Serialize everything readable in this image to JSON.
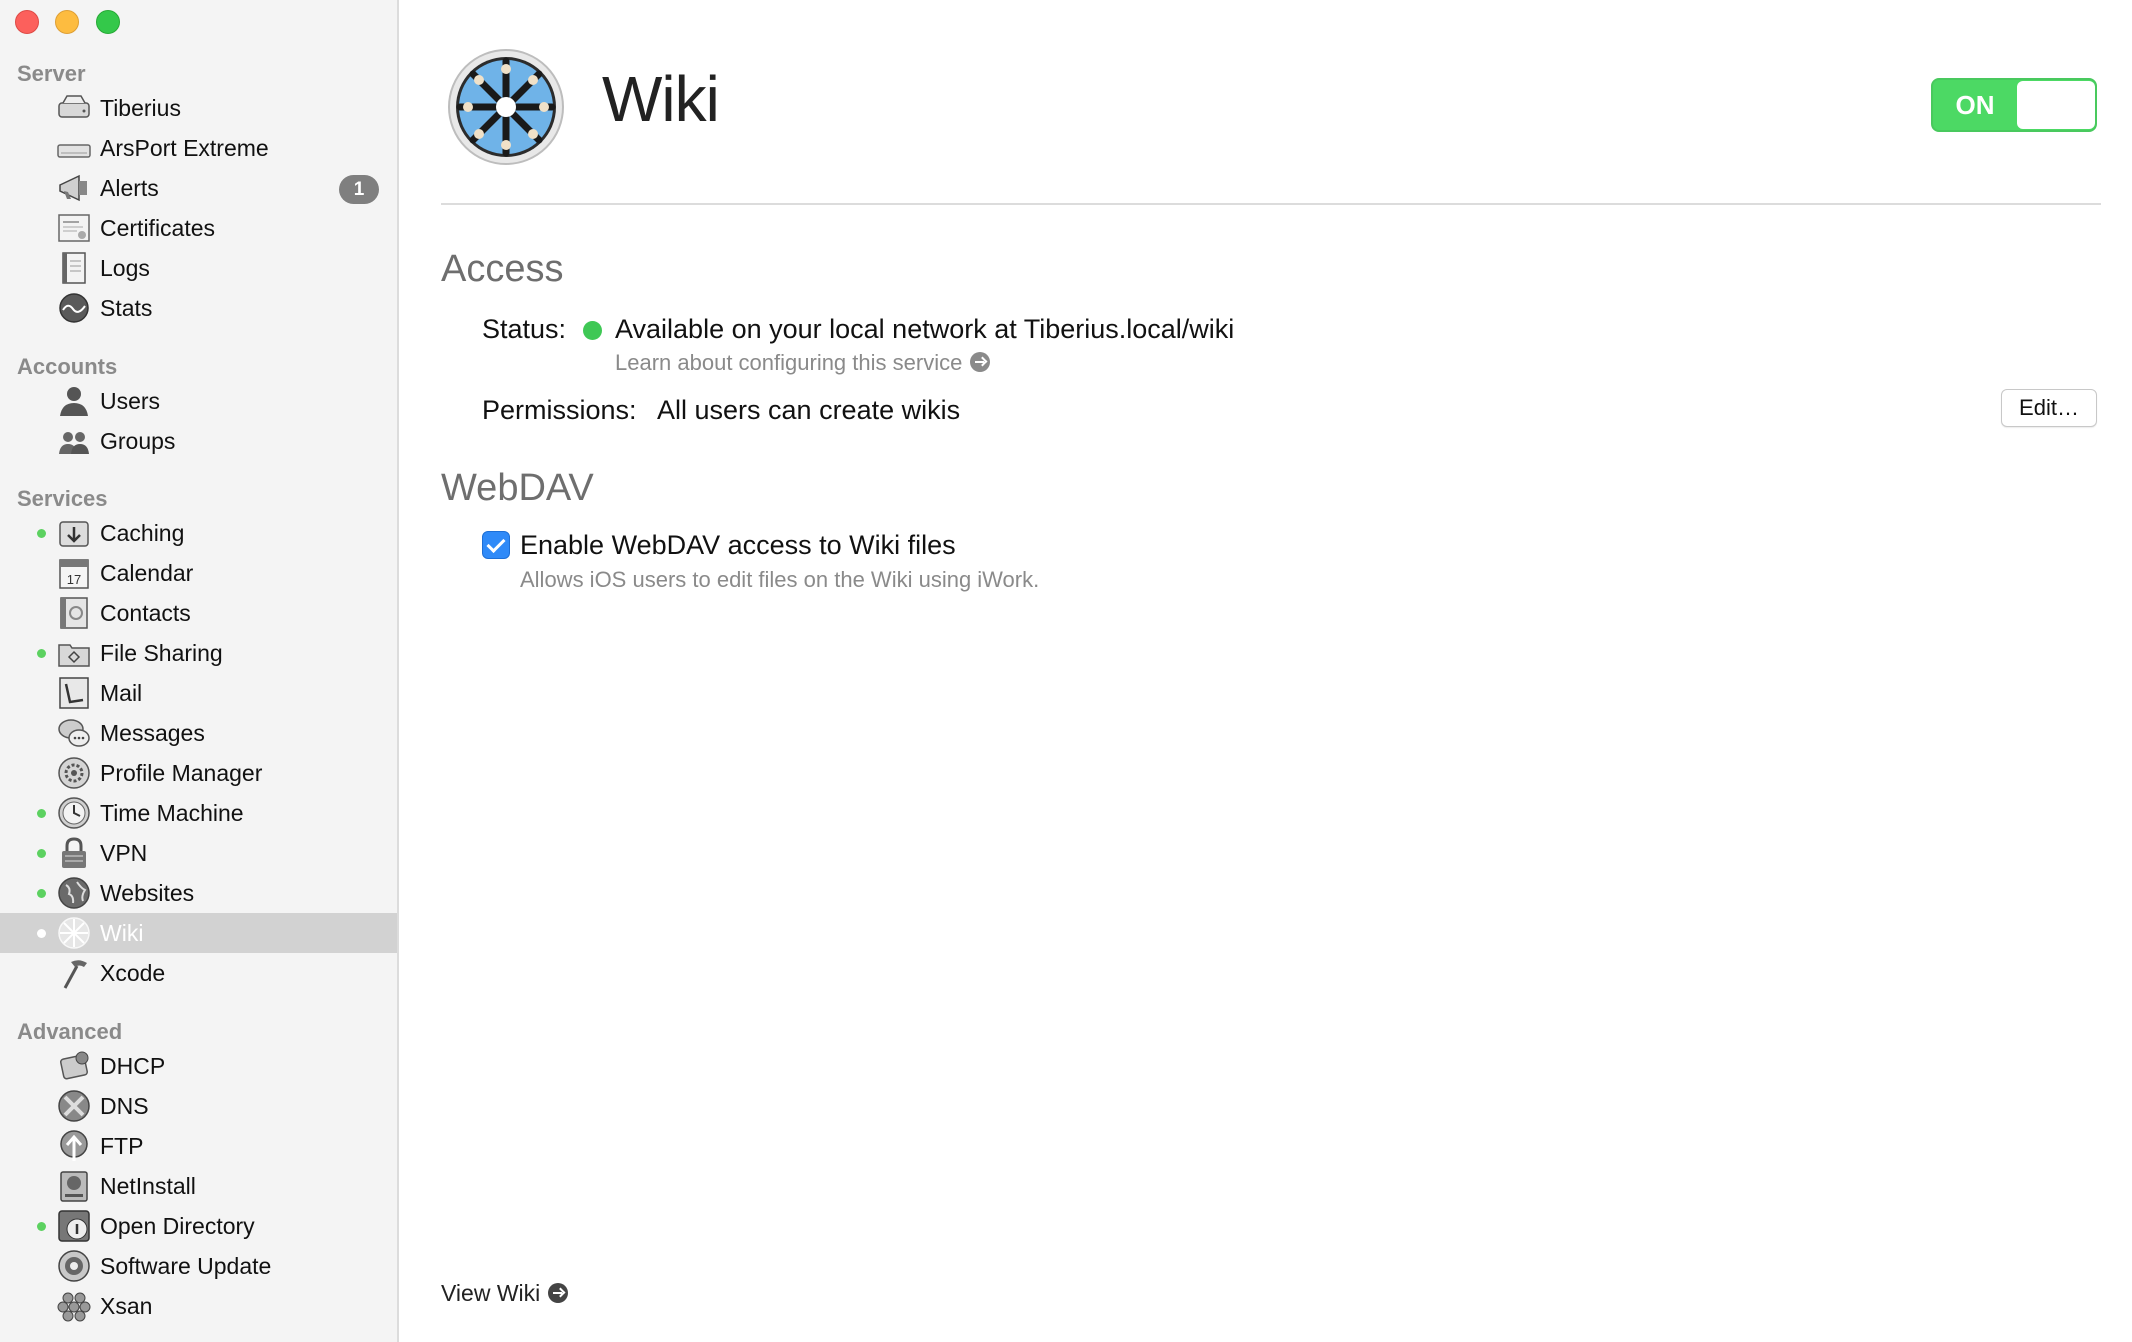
{
  "sidebar": {
    "sections": {
      "server": "Server",
      "accounts": "Accounts",
      "services": "Services",
      "advanced": "Advanced"
    },
    "server_items": [
      {
        "label": "Tiberius",
        "icon": "server-icon"
      },
      {
        "label": "ArsPort Extreme",
        "icon": "airport-icon"
      },
      {
        "label": "Alerts",
        "icon": "megaphone-icon",
        "badge": "1"
      },
      {
        "label": "Certificates",
        "icon": "certificate-icon"
      },
      {
        "label": "Logs",
        "icon": "log-icon"
      },
      {
        "label": "Stats",
        "icon": "stats-icon"
      }
    ],
    "account_items": [
      {
        "label": "Users",
        "icon": "user-icon"
      },
      {
        "label": "Groups",
        "icon": "group-icon"
      }
    ],
    "service_items": [
      {
        "label": "Caching",
        "icon": "caching-icon",
        "running": true
      },
      {
        "label": "Calendar",
        "icon": "calendar-icon",
        "running": false,
        "icon_text": "17"
      },
      {
        "label": "Contacts",
        "icon": "contacts-icon",
        "running": false
      },
      {
        "label": "File Sharing",
        "icon": "file-sharing-icon",
        "running": true
      },
      {
        "label": "Mail",
        "icon": "mail-icon",
        "running": false
      },
      {
        "label": "Messages",
        "icon": "messages-icon",
        "running": false
      },
      {
        "label": "Profile Manager",
        "icon": "profile-manager-icon",
        "running": false
      },
      {
        "label": "Time Machine",
        "icon": "time-machine-icon",
        "running": true
      },
      {
        "label": "VPN",
        "icon": "vpn-icon",
        "running": true
      },
      {
        "label": "Websites",
        "icon": "websites-icon",
        "running": true
      },
      {
        "label": "Wiki",
        "icon": "wiki-icon",
        "running": true,
        "selected": true
      },
      {
        "label": "Xcode",
        "icon": "xcode-icon",
        "running": false
      }
    ],
    "advanced_items": [
      {
        "label": "DHCP",
        "icon": "dhcp-icon",
        "running": false
      },
      {
        "label": "DNS",
        "icon": "dns-icon",
        "running": false
      },
      {
        "label": "FTP",
        "icon": "ftp-icon",
        "running": false
      },
      {
        "label": "NetInstall",
        "icon": "netinstall-icon",
        "running": false
      },
      {
        "label": "Open Directory",
        "icon": "open-directory-icon",
        "running": true
      },
      {
        "label": "Software Update",
        "icon": "software-update-icon",
        "running": false
      },
      {
        "label": "Xsan",
        "icon": "xsan-icon",
        "running": false
      }
    ]
  },
  "main": {
    "title": "Wiki",
    "toggle": {
      "label": "ON",
      "state": "on"
    },
    "access": {
      "heading": "Access",
      "status_label": "Status:",
      "status_value": "Available on your local network at Tiberius.local/wiki",
      "learn_link": "Learn about configuring this service",
      "permissions_label": "Permissions:",
      "permissions_value": "All users can create wikis",
      "edit_button": "Edit…"
    },
    "webdav": {
      "heading": "WebDAV",
      "checkbox_label": "Enable WebDAV access to Wiki files",
      "checked": true,
      "description": "Allows iOS users to edit files on the Wiki using iWork."
    },
    "view_wiki": "View Wiki"
  },
  "colors": {
    "accent": "#2f8af8",
    "toggle_on": "#4cd964",
    "running_dot": "#5cd160",
    "selected_row": "#d2d2d2"
  }
}
